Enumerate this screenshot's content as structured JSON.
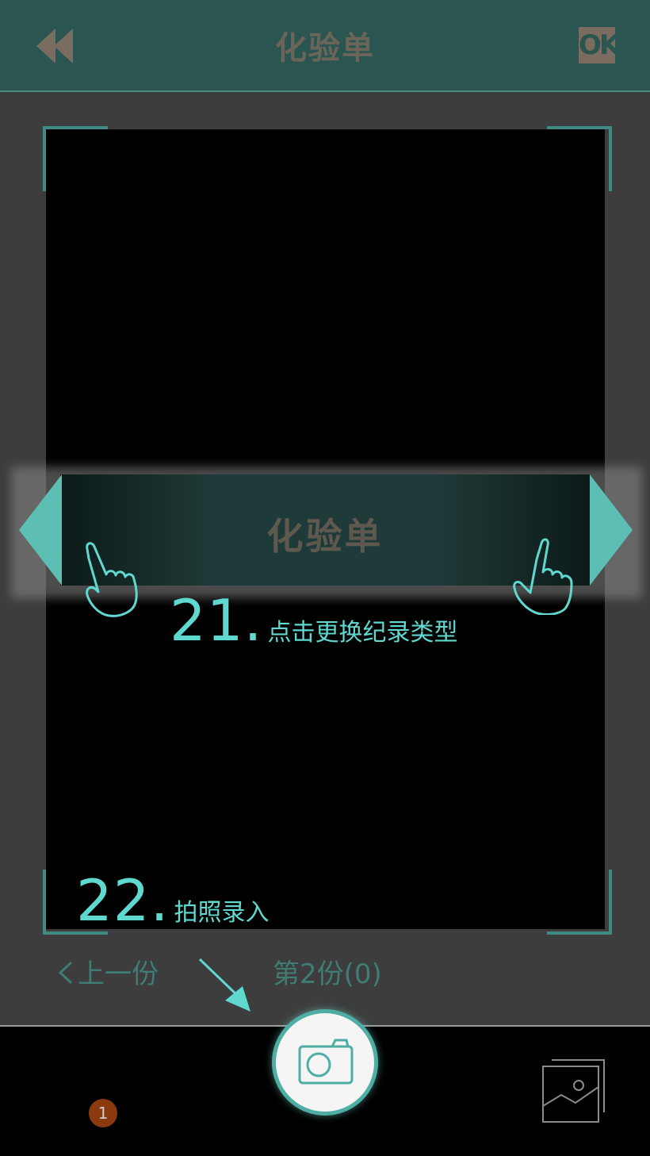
{
  "header": {
    "title": "化验单",
    "back_icon": "double-left-arrow-icon",
    "ok_label": "OK"
  },
  "selector": {
    "type_label": "化验单",
    "prev_icon": "triangle-left-icon",
    "next_icon": "triangle-right-icon"
  },
  "tips": [
    {
      "number": "21.",
      "text": "点击更换纪录类型"
    },
    {
      "number": "22.",
      "text": "拍照录入"
    }
  ],
  "pager": {
    "prev_label": "上一份",
    "current_label": "第2份(0)"
  },
  "bottom": {
    "badge_count": "1",
    "shutter_icon": "camera-icon",
    "gallery_icon": "gallery-icon"
  },
  "colors": {
    "header_bg": "#2b5551",
    "accent": "#5fd8cf",
    "teal": "#4faea4",
    "badge": "#8a3a0d"
  }
}
